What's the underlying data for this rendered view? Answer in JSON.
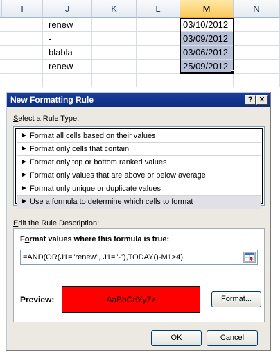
{
  "sheet": {
    "columns": [
      "I",
      "J",
      "K",
      "L",
      "M",
      "N"
    ],
    "rows": [
      {
        "j": "renew",
        "m": "03/10/2012"
      },
      {
        "j": "-",
        "m": "03/09/2012"
      },
      {
        "j": "blabla",
        "m": "03/06/2012"
      },
      {
        "j": "renew",
        "m": "25/09/2012"
      }
    ]
  },
  "dialog": {
    "title": "New Formatting Rule",
    "help_label": "?",
    "close_label": "✕",
    "select_type_label": {
      "key": "S",
      "rest": "elect a Rule Type:"
    },
    "rule_types": [
      "Format all cells based on their values",
      "Format only cells that contain",
      "Format only top or bottom ranked values",
      "Format only values that are above or below average",
      "Format only unique or duplicate values",
      "Use a formula to determine which cells to format"
    ],
    "rule_arrow": "►",
    "edit_desc_label": {
      "key": "E",
      "rest": "dit the Rule Description:"
    },
    "formula_label": {
      "key": "o",
      "pre": "F",
      "rest": "rmat values where this formula is true:"
    },
    "formula_value": "=AND(OR(J1=\"renew\", J1=\"-\"),TODAY()-M1>4)",
    "preview_label": "Preview:",
    "preview_text": "AaBbCcYyZz",
    "format_button": {
      "key": "F",
      "rest": "ormat..."
    },
    "ok_label": "OK",
    "cancel_label": "Cancel"
  },
  "colors": {
    "title_bar": "#0a2c80",
    "preview_fill": "#ff0000",
    "selection": "#b6bfd6",
    "dialog_bg": "#ece9e3"
  }
}
